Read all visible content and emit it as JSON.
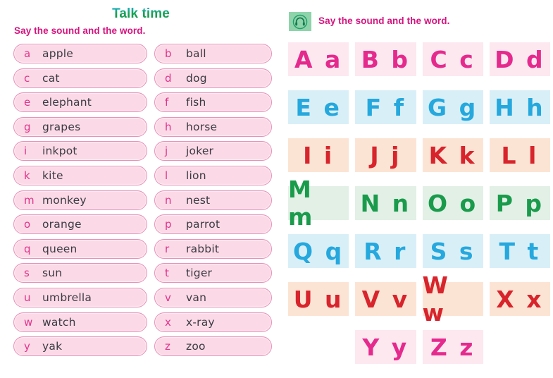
{
  "left": {
    "title": "Talk time",
    "subtitle": "Say the sound and the word.",
    "pills": [
      {
        "letter": "a",
        "word": "apple"
      },
      {
        "letter": "b",
        "word": "ball"
      },
      {
        "letter": "c",
        "word": "cat"
      },
      {
        "letter": "d",
        "word": "dog"
      },
      {
        "letter": "e",
        "word": "elephant"
      },
      {
        "letter": "f",
        "word": "fish"
      },
      {
        "letter": "g",
        "word": "grapes"
      },
      {
        "letter": "h",
        "word": "horse"
      },
      {
        "letter": "i",
        "word": "inkpot"
      },
      {
        "letter": "j",
        "word": "joker"
      },
      {
        "letter": "k",
        "word": "kite"
      },
      {
        "letter": "l",
        "word": "lion"
      },
      {
        "letter": "m",
        "word": "monkey"
      },
      {
        "letter": "n",
        "word": "nest"
      },
      {
        "letter": "o",
        "word": "orange"
      },
      {
        "letter": "p",
        "word": "parrot"
      },
      {
        "letter": "q",
        "word": "queen"
      },
      {
        "letter": "r",
        "word": "rabbit"
      },
      {
        "letter": "s",
        "word": "sun"
      },
      {
        "letter": "t",
        "word": "tiger"
      },
      {
        "letter": "u",
        "word": "umbrella"
      },
      {
        "letter": "v",
        "word": "van"
      },
      {
        "letter": "w",
        "word": "watch"
      },
      {
        "letter": "x",
        "word": "x-ray"
      },
      {
        "letter": "y",
        "word": "yak"
      },
      {
        "letter": "z",
        "word": "zoo"
      }
    ]
  },
  "right": {
    "icon": "headphones-icon",
    "subtitle": "Say the sound and the word.",
    "tiles": [
      {
        "text": "A a",
        "theme": "theme-pink"
      },
      {
        "text": "B b",
        "theme": "theme-pink"
      },
      {
        "text": "C c",
        "theme": "theme-pink"
      },
      {
        "text": "D d",
        "theme": "theme-pink"
      },
      {
        "text": "E e",
        "theme": "theme-blue"
      },
      {
        "text": "F f",
        "theme": "theme-blue"
      },
      {
        "text": "G g",
        "theme": "theme-blue"
      },
      {
        "text": "H h",
        "theme": "theme-blue"
      },
      {
        "text": "I i",
        "theme": "theme-peach"
      },
      {
        "text": "J j",
        "theme": "theme-peach"
      },
      {
        "text": "K k",
        "theme": "theme-peach"
      },
      {
        "text": "L l",
        "theme": "theme-peach"
      },
      {
        "text": "M m",
        "theme": "theme-green"
      },
      {
        "text": "N n",
        "theme": "theme-green"
      },
      {
        "text": "O o",
        "theme": "theme-green"
      },
      {
        "text": "P p",
        "theme": "theme-green"
      },
      {
        "text": "Q q",
        "theme": "theme-blue"
      },
      {
        "text": "R r",
        "theme": "theme-blue"
      },
      {
        "text": "S s",
        "theme": "theme-blue"
      },
      {
        "text": "T t",
        "theme": "theme-blue"
      },
      {
        "text": "U u",
        "theme": "theme-peach"
      },
      {
        "text": "V v",
        "theme": "theme-peach"
      },
      {
        "text": "W w",
        "theme": "theme-peach"
      },
      {
        "text": "X x",
        "theme": "theme-peach"
      },
      {
        "text": "",
        "theme": "empty"
      },
      {
        "text": "Y y",
        "theme": "theme-pink"
      },
      {
        "text": "Z z",
        "theme": "theme-pink"
      },
      {
        "text": "",
        "theme": "empty"
      }
    ]
  },
  "colors": {
    "title_green": "#16a05a",
    "subtitle_magenta": "#d4157f",
    "pill_fill": "#fbd9e6",
    "pill_border": "#e891b6",
    "pill_letter": "#e0348c",
    "pill_word": "#3b3b42",
    "tile_pink_bg": "#fde8f0",
    "tile_pink_fg": "#e52a8e",
    "tile_blue_bg": "#d9eff8",
    "tile_blue_fg": "#25a8dd",
    "tile_peach_bg": "#fce4d4",
    "tile_peach_fg": "#d8242c",
    "tile_green_bg": "#e2f0e6",
    "tile_green_fg": "#1a9b4c",
    "badge_bg": "#8fd3ab"
  }
}
